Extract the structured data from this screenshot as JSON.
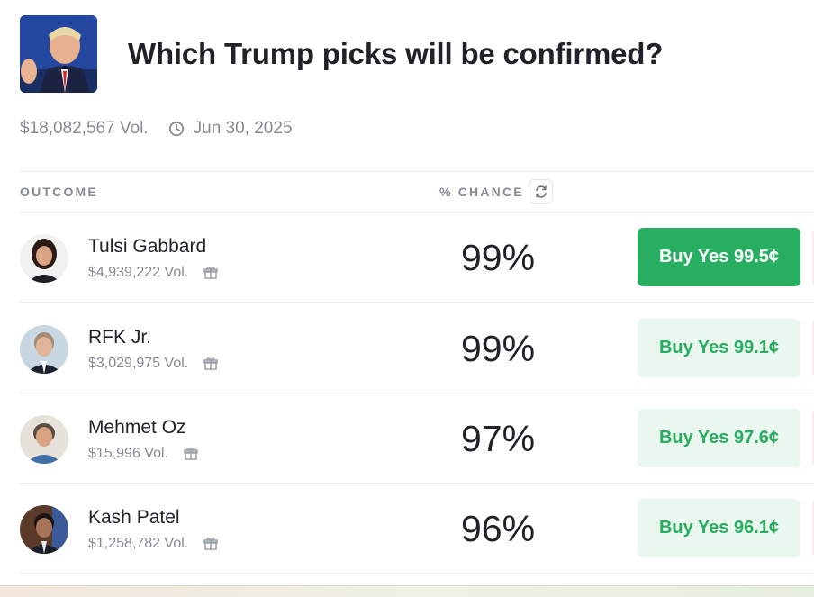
{
  "event": {
    "title": "Which Trump picks will be confirmed?",
    "volume": "$18,082,567 Vol.",
    "end_date": "Jun 30, 2025"
  },
  "table": {
    "outcome_header": "OUTCOME",
    "chance_header": "% CHANCE",
    "rows": [
      {
        "name": "Tulsi Gabbard",
        "volume": "$4,939,222 Vol.",
        "chance": "99%",
        "buy_label": "Buy Yes 99.5¢"
      },
      {
        "name": "RFK Jr.",
        "volume": "$3,029,975 Vol.",
        "chance": "99%",
        "buy_label": "Buy Yes 99.1¢"
      },
      {
        "name": "Mehmet Oz",
        "volume": "$15,996 Vol.",
        "chance": "97%",
        "buy_label": "Buy Yes 97.6¢"
      },
      {
        "name": "Kash Patel",
        "volume": "$1,258,782 Vol.",
        "chance": "96%",
        "buy_label": "Buy Yes 96.1¢"
      }
    ]
  },
  "colors": {
    "yes_green": "#27ae60",
    "yes_soft_bg": "#e9f7ee",
    "no_soft_bg": "#fbeaea",
    "muted_text": "#858b93"
  },
  "icons": {
    "clock": "clock-icon",
    "refresh": "refresh-icon",
    "gift": "gift-icon"
  }
}
